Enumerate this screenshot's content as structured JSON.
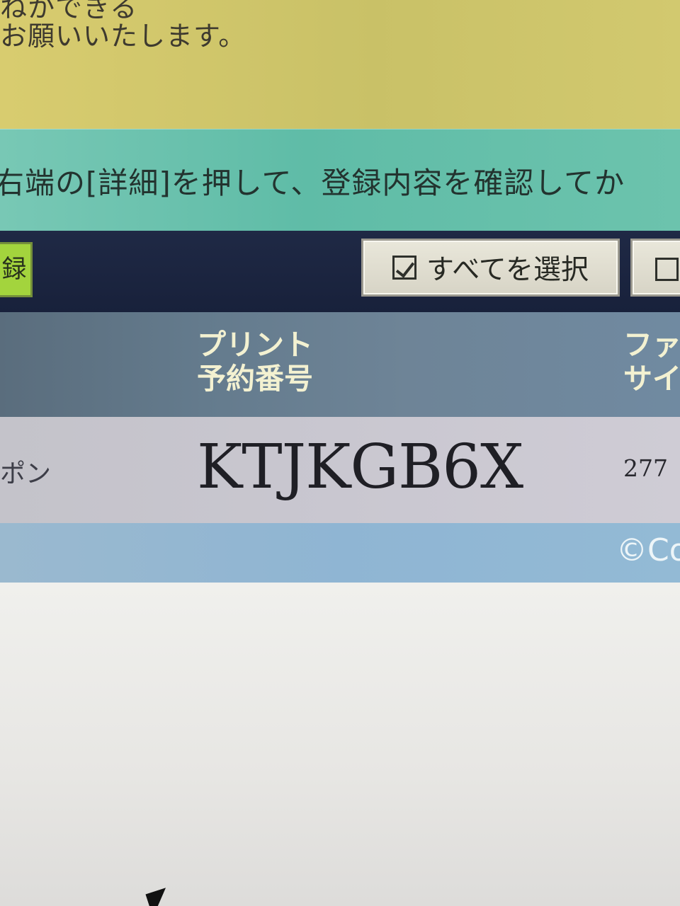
{
  "top_text": {
    "line_partial": "ねかできる",
    "line_main": "お願いいたします。"
  },
  "instruction": {
    "text": "右端の[詳細]を押して、登録内容を確認してか"
  },
  "toolbar": {
    "left_button_label": "録",
    "select_all_label": "すべてを選択",
    "select_all_icon": "checked-box",
    "deselect_icon": "empty-box"
  },
  "table": {
    "columns": [
      {
        "label_line_1": "プリント",
        "label_line_2": "予約番号"
      },
      {
        "label_line_1": "ファ",
        "label_line_2": "サイ"
      }
    ],
    "rows": [
      {
        "left_cell": "ポン",
        "reservation_number": "KTJKGB6X",
        "file_size": "277"
      }
    ]
  },
  "footer": {
    "copyright": "©Co"
  },
  "colors": {
    "yellow_band": "#c9c167",
    "instruction_band": "#5fbca7",
    "toolbar": "#1f2945",
    "header": "#647b8d",
    "row": "#c9c7d0",
    "footer": "#8fb5d3",
    "button_green": "#a3d43d"
  }
}
